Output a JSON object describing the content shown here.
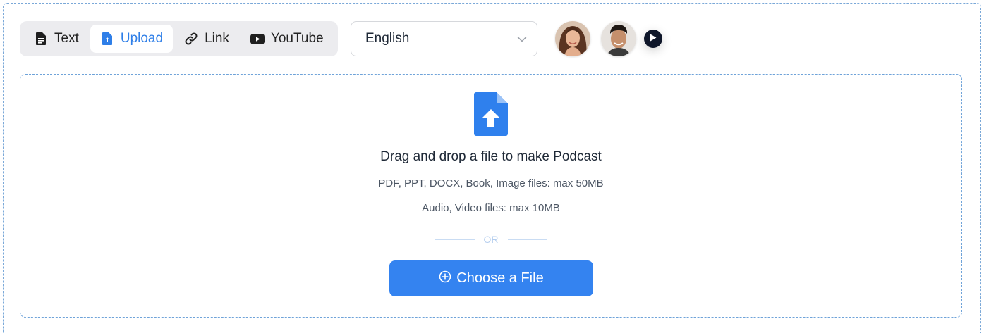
{
  "tabs": [
    {
      "label": "Text",
      "icon": "document-icon",
      "active": false
    },
    {
      "label": "Upload",
      "icon": "upload-file-icon",
      "active": true
    },
    {
      "label": "Link",
      "icon": "link-icon",
      "active": false
    },
    {
      "label": "YouTube",
      "icon": "youtube-icon",
      "active": false
    }
  ],
  "language": {
    "selected": "English"
  },
  "hosts": [
    {
      "name": "female-host-avatar"
    },
    {
      "name": "male-host-avatar"
    }
  ],
  "dropzone": {
    "title": "Drag and drop a file to make Podcast",
    "hint_documents": "PDF, PPT, DOCX, Book, Image files: max 50MB",
    "hint_media": "Audio, Video files: max 10MB",
    "divider": "OR",
    "button_label": "Choose a File"
  },
  "colors": {
    "accent": "#3483f0",
    "active_tab_text": "#2f7fe8",
    "tab_group_bg": "#ececef",
    "dashed_border": "#6fa3d9"
  }
}
